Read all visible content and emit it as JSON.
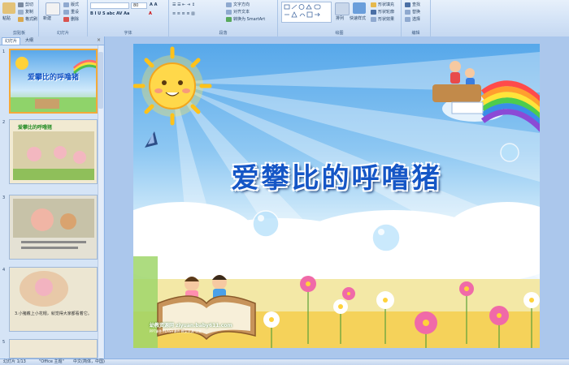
{
  "ribbon": {
    "clipboard": {
      "label": "剪贴板",
      "paste": "粘贴",
      "cut": "剪切",
      "copy": "复制",
      "format_painter": "格式刷"
    },
    "slides": {
      "label": "幻灯片",
      "new_slide": "新建\n幻灯片",
      "layout": "版式",
      "reset": "重设",
      "delete": "删除"
    },
    "font": {
      "label": "字体",
      "font_size": "80"
    },
    "paragraph": {
      "label": "段落",
      "text_direction": "文字方向",
      "align_text": "对齐文本",
      "smartart": "转换为 SmartArt"
    },
    "drawing": {
      "label": "绘图",
      "arrange": "排列",
      "quick_styles": "快速样式",
      "shape_fill": "形状填充",
      "shape_outline": "形状轮廓",
      "shape_effects": "形状效果"
    },
    "editing": {
      "label": "编辑",
      "find": "查找",
      "replace": "替换",
      "select": "选择"
    }
  },
  "pane": {
    "tabs": [
      "幻灯片",
      "大纲"
    ],
    "thumbs": [
      {
        "num": "1",
        "title": "爱攀比的呼噜猪"
      },
      {
        "num": "2",
        "title": "爱攀比的呼噜猪"
      },
      {
        "num": "3",
        "title": ""
      },
      {
        "num": "4",
        "title": "3.小猪戴上小花帽，就觉得大家都看着它。"
      },
      {
        "num": "5",
        "title": ""
      }
    ]
  },
  "slide": {
    "title": "爱攀比的呼噜猪",
    "caption": "幼教资源网 ziyuan.baby611.com",
    "caption_sub": "PPT课件·FLASH课件·教案资源·论文"
  },
  "status": {
    "slide_pos": "幻灯片 1/13",
    "theme": "\"Office 主题\"",
    "language": "中文(简体，中国)"
  },
  "colors": {
    "accent": "#1556c6",
    "ribbon_bg": "#d2e2f6",
    "selection": "#f4a938"
  }
}
